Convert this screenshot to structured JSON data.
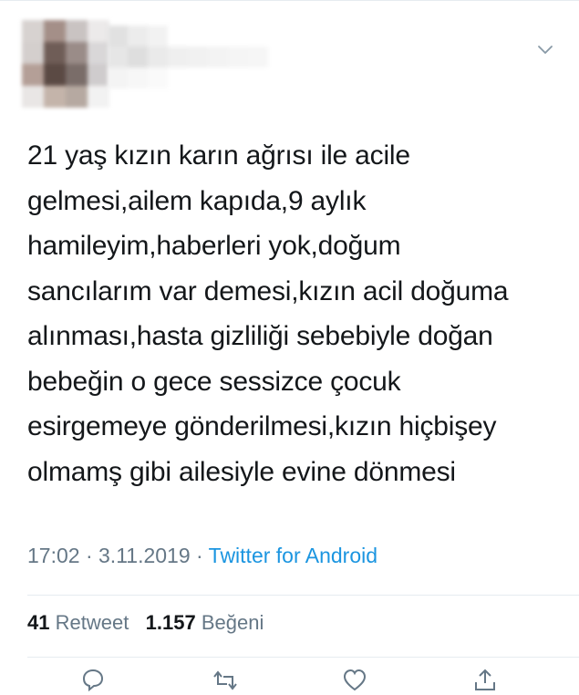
{
  "header": {
    "avatar_icon": "avatar-blurred",
    "name_icon": "username-blurred",
    "menu_icon": "chevron-down-icon"
  },
  "tweet": {
    "text": "21 yaş kızın karın ağrısı ile acile\ngelmesi,ailem kapıda,9 aylık\nhamileyim,haberleri yok,doğum\nsancılarım var demesi,kızın acil doğuma\nalınması,hasta gizliliği sebebiyle doğan\nbebeğin o gece sessizce çocuk\nesirgemeye gönderilmesi,kızın hiçbişey\nolmamş gibi ailesiyle evine dönmesi",
    "time": "17:02",
    "separator1": " · ",
    "date": "3.11.2019",
    "separator2": " · ",
    "source": "Twitter for Android"
  },
  "stats": {
    "retweet_count": "41",
    "retweet_label": "Retweet",
    "like_count": "1.157",
    "like_label": "Beğeni"
  },
  "actions": {
    "icons": [
      "reply-icon",
      "retweet-icon",
      "like-icon",
      "share-icon"
    ]
  },
  "colors": {
    "text": "#14171a",
    "secondary": "#657786",
    "link": "#1b95e0",
    "divider": "#e6ecf0"
  }
}
